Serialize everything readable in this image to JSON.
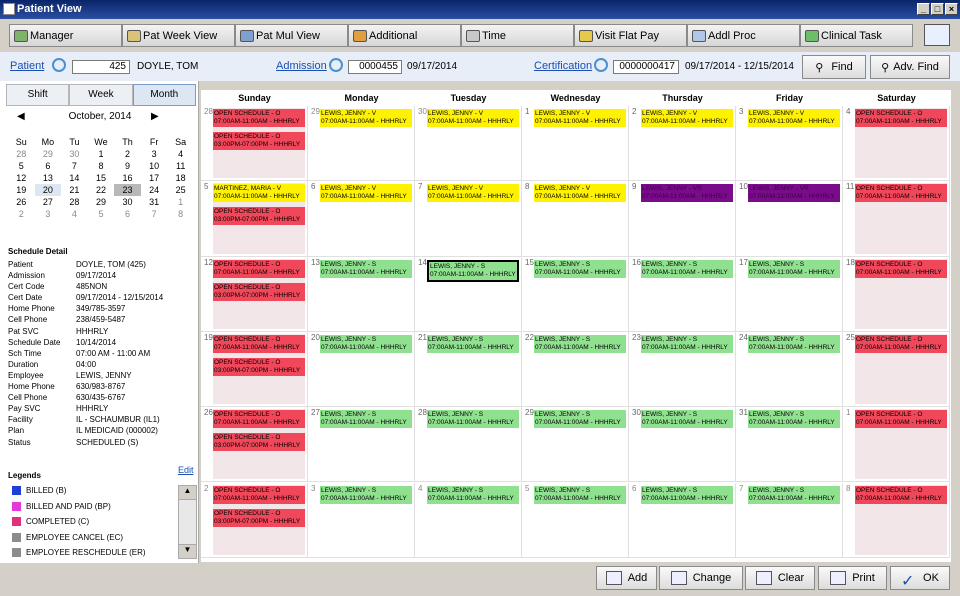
{
  "window": {
    "title": "Patient View"
  },
  "toolbar": [
    {
      "label": "Manager",
      "icon": "manager-icon"
    },
    {
      "label": "Pat Week View",
      "icon": "calendar-icon"
    },
    {
      "label": "Pat Mul View",
      "icon": "people-icon"
    },
    {
      "label": "Additional",
      "icon": "list-icon"
    },
    {
      "label": "Time",
      "icon": "clock-icon"
    },
    {
      "label": "Visit Flat Pay",
      "icon": "pay-icon"
    },
    {
      "label": "Addl Proc",
      "icon": "document-icon"
    },
    {
      "label": "Clinical Task",
      "icon": "task-icon"
    }
  ],
  "filters": {
    "patient_label": "Patient",
    "patient_id": "425",
    "patient_name": "DOYLE, TOM",
    "admission_label": "Admission",
    "admission_id": "0000455",
    "admission_date": "09/17/2014",
    "cert_label": "Certification",
    "cert_id": "0000000417",
    "cert_range": "09/17/2014 - 12/15/2014",
    "find": "Find",
    "adv_find": "Adv. Find"
  },
  "view_tabs": [
    "Shift",
    "Week",
    "Month"
  ],
  "mini_cal": {
    "month": "October, 2014",
    "days": [
      "Su",
      "Mo",
      "Tu",
      "We",
      "Th",
      "Fr",
      "Sa"
    ],
    "weeks": [
      [
        "28",
        "29",
        "30",
        "1",
        "2",
        "3",
        "4"
      ],
      [
        "5",
        "6",
        "7",
        "8",
        "9",
        "10",
        "11"
      ],
      [
        "12",
        "13",
        "14",
        "15",
        "16",
        "17",
        "18"
      ],
      [
        "19",
        "20",
        "21",
        "22",
        "23",
        "24",
        "25"
      ],
      [
        "26",
        "27",
        "28",
        "29",
        "30",
        "31",
        "1"
      ],
      [
        "2",
        "3",
        "4",
        "5",
        "6",
        "7",
        "8"
      ]
    ]
  },
  "schedule_detail": {
    "header": "Schedule Detail",
    "rows": [
      [
        "Patient",
        "DOYLE, TOM (425)"
      ],
      [
        "Admission",
        "09/17/2014"
      ],
      [
        "Cert Code",
        "485NON"
      ],
      [
        "Cert Date",
        "09/17/2014 - 12/15/2014"
      ],
      [
        "Home Phone",
        "349/785-3597"
      ],
      [
        "Cell Phone",
        "238/459-5487"
      ],
      [
        "Pat SVC",
        "HHHRLY"
      ],
      [
        "Schedule Date",
        "10/14/2014"
      ],
      [
        "Sch Time",
        "07:00 AM - 11:00 AM"
      ],
      [
        "Duration",
        "04:00"
      ],
      [
        "Employee",
        "LEWIS, JENNY"
      ],
      [
        "Home Phone",
        "630/983-8767"
      ],
      [
        "Cell Phone",
        "630/435-6767"
      ],
      [
        "Pay SVC",
        "HHHRLY"
      ],
      [
        "Facility",
        "IL - SCHAUMBUR (IL1)"
      ],
      [
        "Plan",
        "IL MEDICAID (000002)"
      ],
      [
        "Status",
        "SCHEDULED (S)"
      ]
    ],
    "edit": "Edit"
  },
  "legends": {
    "header": "Legends",
    "items": [
      {
        "label": "BILLED (B)",
        "color": "#1f3fd6"
      },
      {
        "label": "BILLED AND PAID (BP)",
        "color": "#e23ad8"
      },
      {
        "label": "COMPLETED (C)",
        "color": "#e0307a"
      },
      {
        "label": "EMPLOYEE CANCEL (EC)",
        "color": "#8c8c8c"
      },
      {
        "label": "EMPLOYEE RESCHEDULE (ER)",
        "color": "#8c8c8c"
      }
    ]
  },
  "calendar": {
    "days": [
      "Sunday",
      "Monday",
      "Tuesday",
      "Wednesday",
      "Thursday",
      "Friday",
      "Saturday"
    ],
    "weeks": [
      [
        {
          "d": "28",
          "dim": true,
          "e": [
            [
              "OPEN SCHEDULE - O",
              "07:00AM-11:00AM - HHHRLY",
              "red"
            ],
            [
              "OPEN SCHEDULE - O",
              "03:00PM-07:00PM - HHHRLY",
              "red"
            ]
          ]
        },
        {
          "d": "29",
          "dim": true,
          "e": [
            [
              "LEWIS, JENNY - V",
              "07:00AM-11:00AM - HHHRLY",
              "yellow"
            ]
          ]
        },
        {
          "d": "30",
          "dim": true,
          "e": [
            [
              "LEWIS, JENNY - V",
              "07:00AM-11:00AM - HHHRLY",
              "yellow"
            ]
          ]
        },
        {
          "d": "1",
          "e": [
            [
              "LEWIS, JENNY - V",
              "07:00AM-11:00AM - HHHRLY",
              "yellow"
            ]
          ]
        },
        {
          "d": "2",
          "e": [
            [
              "LEWIS, JENNY - V",
              "07:00AM-11:00AM - HHHRLY",
              "yellow"
            ]
          ]
        },
        {
          "d": "3",
          "e": [
            [
              "LEWIS, JENNY - V",
              "07:00AM-11:00AM - HHHRLY",
              "yellow"
            ]
          ]
        },
        {
          "d": "4",
          "e": [
            [
              "OPEN SCHEDULE - O",
              "07:00AM-11:00AM - HHHRLY",
              "red"
            ]
          ]
        }
      ],
      [
        {
          "d": "5",
          "e": [
            [
              "MARTINEZ, MARIA - V",
              "07:00AM-11:00AM - HHHRLY",
              "yellow"
            ],
            [
              "OPEN SCHEDULE - O",
              "03:00PM-07:00PM - HHHRLY",
              "red"
            ]
          ]
        },
        {
          "d": "6",
          "e": [
            [
              "LEWIS, JENNY - V",
              "07:00AM-11:00AM - HHHRLY",
              "yellow"
            ]
          ]
        },
        {
          "d": "7",
          "e": [
            [
              "LEWIS, JENNY - V",
              "07:00AM-11:00AM - HHHRLY",
              "yellow"
            ]
          ]
        },
        {
          "d": "8",
          "e": [
            [
              "LEWIS, JENNY - V",
              "07:00AM-11:00AM - HHHRLY",
              "yellow"
            ]
          ]
        },
        {
          "d": "9",
          "e": [
            [
              "LEWIS, JENNY - VR",
              "07:00AM-11:00AM - HHHRLY",
              "purple"
            ]
          ]
        },
        {
          "d": "10",
          "e": [
            [
              "LEWIS, JENNY - VR",
              "07:00AM-11:00AM - HHHRLY",
              "purple"
            ]
          ]
        },
        {
          "d": "11",
          "e": [
            [
              "OPEN SCHEDULE - O",
              "07:00AM-11:00AM - HHHRLY",
              "red"
            ]
          ]
        }
      ],
      [
        {
          "d": "12",
          "e": [
            [
              "OPEN SCHEDULE - O",
              "07:00AM-11:00AM - HHHRLY",
              "red"
            ],
            [
              "OPEN SCHEDULE - O",
              "03:00PM-07:00PM - HHHRLY",
              "red"
            ]
          ]
        },
        {
          "d": "13",
          "e": [
            [
              "LEWIS, JENNY - S",
              "07:00AM-11:00AM - HHHRLY",
              "green"
            ]
          ]
        },
        {
          "d": "14",
          "e": [
            [
              "LEWIS, JENNY - S",
              "07:00AM-11:00AM - HHHRLY",
              "green"
            ]
          ]
        },
        {
          "d": "15",
          "e": [
            [
              "LEWIS, JENNY - S",
              "07:00AM-11:00AM - HHHRLY",
              "green"
            ]
          ]
        },
        {
          "d": "16",
          "e": [
            [
              "LEWIS, JENNY - S",
              "07:00AM-11:00AM - HHHRLY",
              "green"
            ]
          ]
        },
        {
          "d": "17",
          "e": [
            [
              "LEWIS, JENNY - S",
              "07:00AM-11:00AM - HHHRLY",
              "green"
            ]
          ]
        },
        {
          "d": "18",
          "e": [
            [
              "OPEN SCHEDULE - O",
              "07:00AM-11:00AM - HHHRLY",
              "red"
            ]
          ]
        }
      ],
      [
        {
          "d": "19",
          "e": [
            [
              "OPEN SCHEDULE - O",
              "07:00AM-11:00AM - HHHRLY",
              "red"
            ],
            [
              "OPEN SCHEDULE - O",
              "03:00PM-07:00PM - HHHRLY",
              "red"
            ]
          ]
        },
        {
          "d": "20",
          "e": [
            [
              "LEWIS, JENNY - S",
              "07:00AM-11:00AM - HHHRLY",
              "green"
            ]
          ]
        },
        {
          "d": "21",
          "e": [
            [
              "LEWIS, JENNY - S",
              "07:00AM-11:00AM - HHHRLY",
              "green"
            ]
          ]
        },
        {
          "d": "22",
          "e": [
            [
              "LEWIS, JENNY - S",
              "07:00AM-11:00AM - HHHRLY",
              "green"
            ]
          ]
        },
        {
          "d": "23",
          "e": [
            [
              "LEWIS, JENNY - S",
              "07:00AM-11:00AM - HHHRLY",
              "green"
            ]
          ]
        },
        {
          "d": "24",
          "e": [
            [
              "LEWIS, JENNY - S",
              "07:00AM-11:00AM - HHHRLY",
              "green"
            ]
          ]
        },
        {
          "d": "25",
          "e": [
            [
              "OPEN SCHEDULE - O",
              "07:00AM-11:00AM - HHHRLY",
              "red"
            ]
          ]
        }
      ],
      [
        {
          "d": "26",
          "e": [
            [
              "OPEN SCHEDULE - O",
              "07:00AM-11:00AM - HHHRLY",
              "red"
            ],
            [
              "OPEN SCHEDULE - O",
              "03:00PM-07:00PM - HHHRLY",
              "red"
            ]
          ]
        },
        {
          "d": "27",
          "e": [
            [
              "LEWIS, JENNY - S",
              "07:00AM-11:00AM - HHHRLY",
              "green"
            ]
          ]
        },
        {
          "d": "28",
          "e": [
            [
              "LEWIS, JENNY - S",
              "07:00AM-11:00AM - HHHRLY",
              "green"
            ]
          ]
        },
        {
          "d": "29",
          "e": [
            [
              "LEWIS, JENNY - S",
              "07:00AM-11:00AM - HHHRLY",
              "green"
            ]
          ]
        },
        {
          "d": "30",
          "e": [
            [
              "LEWIS, JENNY - S",
              "07:00AM-11:00AM - HHHRLY",
              "green"
            ]
          ]
        },
        {
          "d": "31",
          "e": [
            [
              "LEWIS, JENNY - S",
              "07:00AM-11:00AM - HHHRLY",
              "green"
            ]
          ]
        },
        {
          "d": "1",
          "dim": true,
          "e": [
            [
              "OPEN SCHEDULE - O",
              "07:00AM-11:00AM - HHHRLY",
              "red"
            ]
          ]
        }
      ],
      [
        {
          "d": "2",
          "dim": true,
          "e": [
            [
              "OPEN SCHEDULE - O",
              "07:00AM-11:00AM - HHHRLY",
              "red"
            ],
            [
              "OPEN SCHEDULE - O",
              "03:00PM-07:00PM - HHHRLY",
              "red"
            ]
          ]
        },
        {
          "d": "3",
          "dim": true,
          "e": [
            [
              "LEWIS, JENNY - S",
              "07:00AM-11:00AM - HHHRLY",
              "green"
            ]
          ]
        },
        {
          "d": "4",
          "dim": true,
          "e": [
            [
              "LEWIS, JENNY - S",
              "07:00AM-11:00AM - HHHRLY",
              "green"
            ]
          ]
        },
        {
          "d": "5",
          "dim": true,
          "e": [
            [
              "LEWIS, JENNY - S",
              "07:00AM-11:00AM - HHHRLY",
              "green"
            ]
          ]
        },
        {
          "d": "6",
          "dim": true,
          "e": [
            [
              "LEWIS, JENNY - S",
              "07:00AM-11:00AM - HHHRLY",
              "green"
            ]
          ]
        },
        {
          "d": "7",
          "dim": true,
          "e": [
            [
              "LEWIS, JENNY - S",
              "07:00AM-11:00AM - HHHRLY",
              "green"
            ]
          ]
        },
        {
          "d": "8",
          "dim": true,
          "e": [
            [
              "OPEN SCHEDULE - O",
              "07:00AM-11:00AM - HHHRLY",
              "red"
            ]
          ]
        }
      ]
    ]
  },
  "colors": {
    "red": "#f0485a",
    "yellow": "#fff200",
    "green": "#8fe08f",
    "purple": "#7a0c8c"
  },
  "actions": [
    {
      "label": "Add",
      "icon": "add-icon"
    },
    {
      "label": "Change",
      "icon": "change-icon"
    },
    {
      "label": "Clear",
      "icon": "clear-icon"
    },
    {
      "label": "Print",
      "icon": "print-icon"
    },
    {
      "label": "OK",
      "icon": "ok-icon"
    }
  ]
}
